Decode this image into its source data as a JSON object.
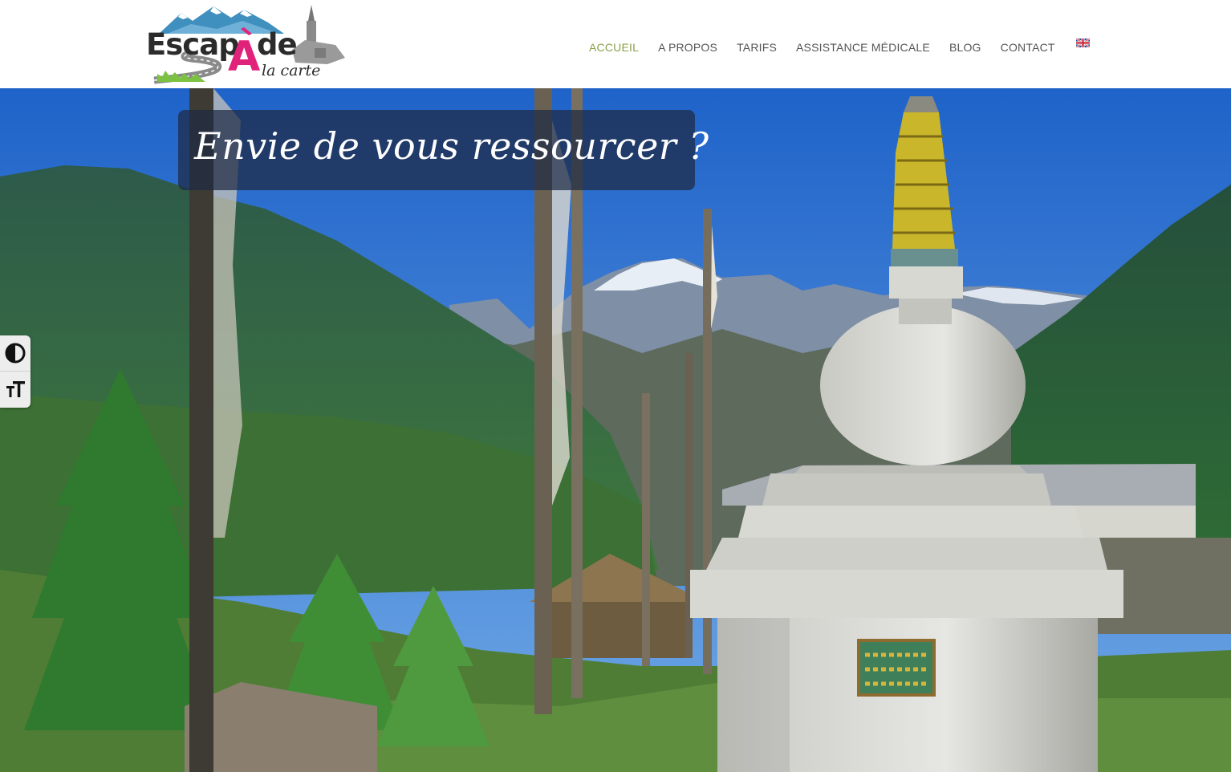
{
  "brand": {
    "logo_main": "EscapAde",
    "logo_sub": "la carte",
    "colors": {
      "mountain": "#3f8fbf",
      "snow": "#ffffff",
      "accent_pink": "#e0227a",
      "grass": "#7cc242",
      "text": "#2b2b2b"
    }
  },
  "nav": {
    "items": [
      {
        "label": "ACCUEIL",
        "active": true
      },
      {
        "label": "A PROPOS",
        "active": false
      },
      {
        "label": "TARIFS",
        "active": false
      },
      {
        "label": "ASSISTANCE MÉDICALE",
        "active": false
      },
      {
        "label": "BLOG",
        "active": false
      },
      {
        "label": "CONTACT",
        "active": false
      }
    ],
    "language_flag": "uk-flag-icon",
    "active_color": "#8aa04a",
    "text_color": "#555555"
  },
  "hero": {
    "headline": "Envie de vous ressourcer ?",
    "image": "himalayan-stupa-landscape"
  },
  "accessibility": {
    "contrast_icon": "contrast-icon",
    "font_size_icon": "font-size-icon"
  }
}
